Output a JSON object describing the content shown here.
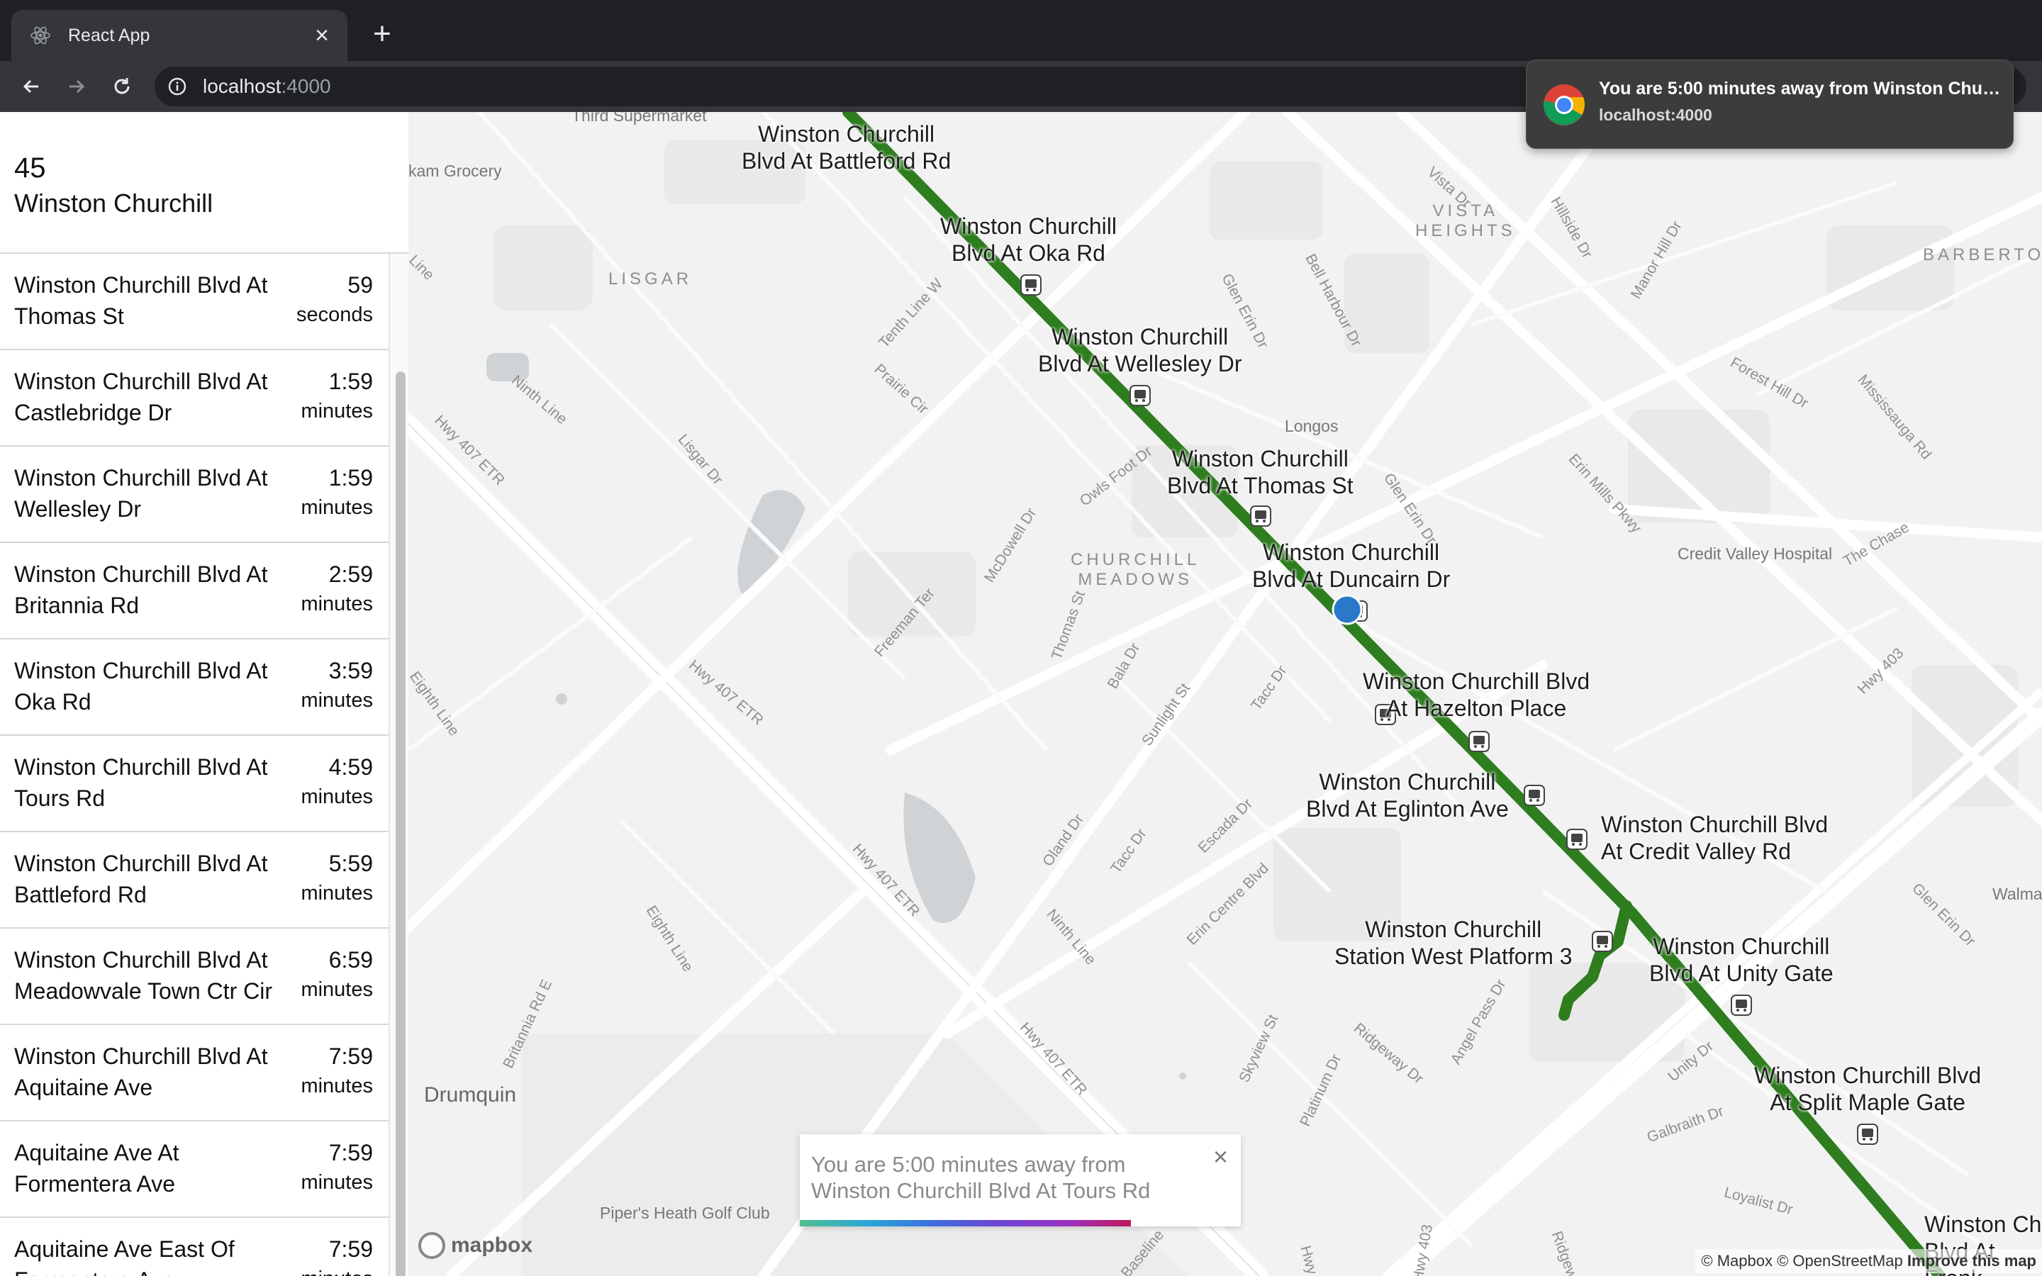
{
  "browser": {
    "tab_title": "React App",
    "url_host": "localhost",
    "url_port": ":4000",
    "icons": {
      "favicon": "react-atom-icon",
      "close": "close-icon",
      "new_tab": "plus-icon",
      "back": "arrow-left-icon",
      "forward": "arrow-right-icon",
      "reload": "reload-icon",
      "site_info": "info-icon"
    }
  },
  "notification": {
    "title": "You are 5:00 minutes away from Winston Churc...",
    "source": "localhost:4000",
    "icon": "chrome-icon"
  },
  "sidebar": {
    "route_number": "45",
    "route_name": "Winston Churchill",
    "stops": [
      {
        "name": "Winston Churchill Blvd At Thomas St",
        "time": "59",
        "unit": "seconds"
      },
      {
        "name": "Winston Churchill Blvd At Castlebridge Dr",
        "time": "1:59",
        "unit": "minutes"
      },
      {
        "name": "Winston Churchill Blvd At Wellesley Dr",
        "time": "1:59",
        "unit": "minutes"
      },
      {
        "name": "Winston Churchill Blvd At Britannia Rd",
        "time": "2:59",
        "unit": "minutes"
      },
      {
        "name": "Winston Churchill Blvd At Oka Rd",
        "time": "3:59",
        "unit": "minutes"
      },
      {
        "name": "Winston Churchill Blvd At Tours Rd",
        "time": "4:59",
        "unit": "minutes"
      },
      {
        "name": "Winston Churchill Blvd At Battleford Rd",
        "time": "5:59",
        "unit": "minutes"
      },
      {
        "name": "Winston Churchill Blvd At Meadowvale Town Ctr Cir",
        "time": "6:59",
        "unit": "minutes"
      },
      {
        "name": "Winston Churchill Blvd At Aquitaine Ave",
        "time": "7:59",
        "unit": "minutes"
      },
      {
        "name": "Aquitaine Ave At Formentera Ave",
        "time": "7:59",
        "unit": "minutes"
      },
      {
        "name": "Aquitaine Ave East Of Formentera Ave",
        "time": "7:59",
        "unit": "minutes"
      }
    ]
  },
  "map": {
    "route_color": "#2e7d1f",
    "user_location_color": "#2a78c8",
    "stop_labels": [
      "Winston Churchill\nBlvd At Battleford Rd",
      "Winston Churchill\nBlvd At Oka Rd",
      "Winston Churchill\nBlvd At Wellesley Dr",
      "Winston Churchill\nBlvd At Thomas St",
      "Winston Churchill\nBlvd At Duncairn Dr",
      "Winston Churchill Blvd\nAt Hazelton Place",
      "Winston Churchill\nBlvd At Eglinton Ave",
      "Winston Churchill Blvd\nAt Credit Valley Rd",
      "Winston Churchill\nStation West Platform 3",
      "Winston Churchill\nBlvd At Unity Gate",
      "Winston Churchill Blvd\nAt Split Maple Gate",
      "Winston Ch\nBlvd At Frank"
    ],
    "area_labels": [
      "VISTA\nHEIGHTS",
      "LISGAR",
      "CHURCHILL\nMEADOWS",
      "BARBERTOWN"
    ],
    "place_labels": [
      "Longos",
      "Credit Valley Hospital",
      "Drumquin",
      "Piper's Heath Golf Club",
      "kam Grocery",
      "Walma",
      "Third Supermarket"
    ],
    "street_labels": [
      "Vista Dr",
      "Hillside Dr",
      "Manor Hill Dr",
      "Bell Harbour Dr",
      "Glen Erin Dr",
      "Tenth Line W",
      "Prairie Cir",
      "Ninth Line",
      "Hwy 407 ETR",
      "Lisgar Dr",
      "Owls Foot Dr",
      "McDowell Dr",
      "Glen Erin Dr",
      "Erin Mills Pkwy",
      "Forest Hill Dr",
      "Mississauga Rd",
      "The Chase",
      "Hwy 403",
      "Freeman Ter",
      "Thomas St",
      "Bala Dr",
      "Sunlight St",
      "Tacc Dr",
      "Eighth Line",
      "Hwy 407 ETR",
      "Oland Dr",
      "Tacc Dr",
      "Escada Dr",
      "Erin Centre Blvd",
      "Ninth Line",
      "Hwy 407 ETR",
      "Eighth Line",
      "Britannia Rd E",
      "Hwy 407 ETR",
      "Skyview St",
      "Ridgeway Dr",
      "Angel Pass Dr",
      "Platinum Dr",
      "Unity Dr",
      "Galbraith Dr",
      "Loyalist Dr",
      "Ridgeway",
      "Hwy 403",
      "Hwy 407",
      "Glen Erin Dr",
      "Line",
      "Baseline"
    ],
    "popup": {
      "message": "You are 5:00 minutes away from Winston Churchill Blvd At Tours Rd",
      "close": "×",
      "progress": 0.75
    },
    "logo": "mapbox",
    "attribution_a": "© Mapbox © OpenStreetMap",
    "attribution_b": "Improve this map"
  }
}
